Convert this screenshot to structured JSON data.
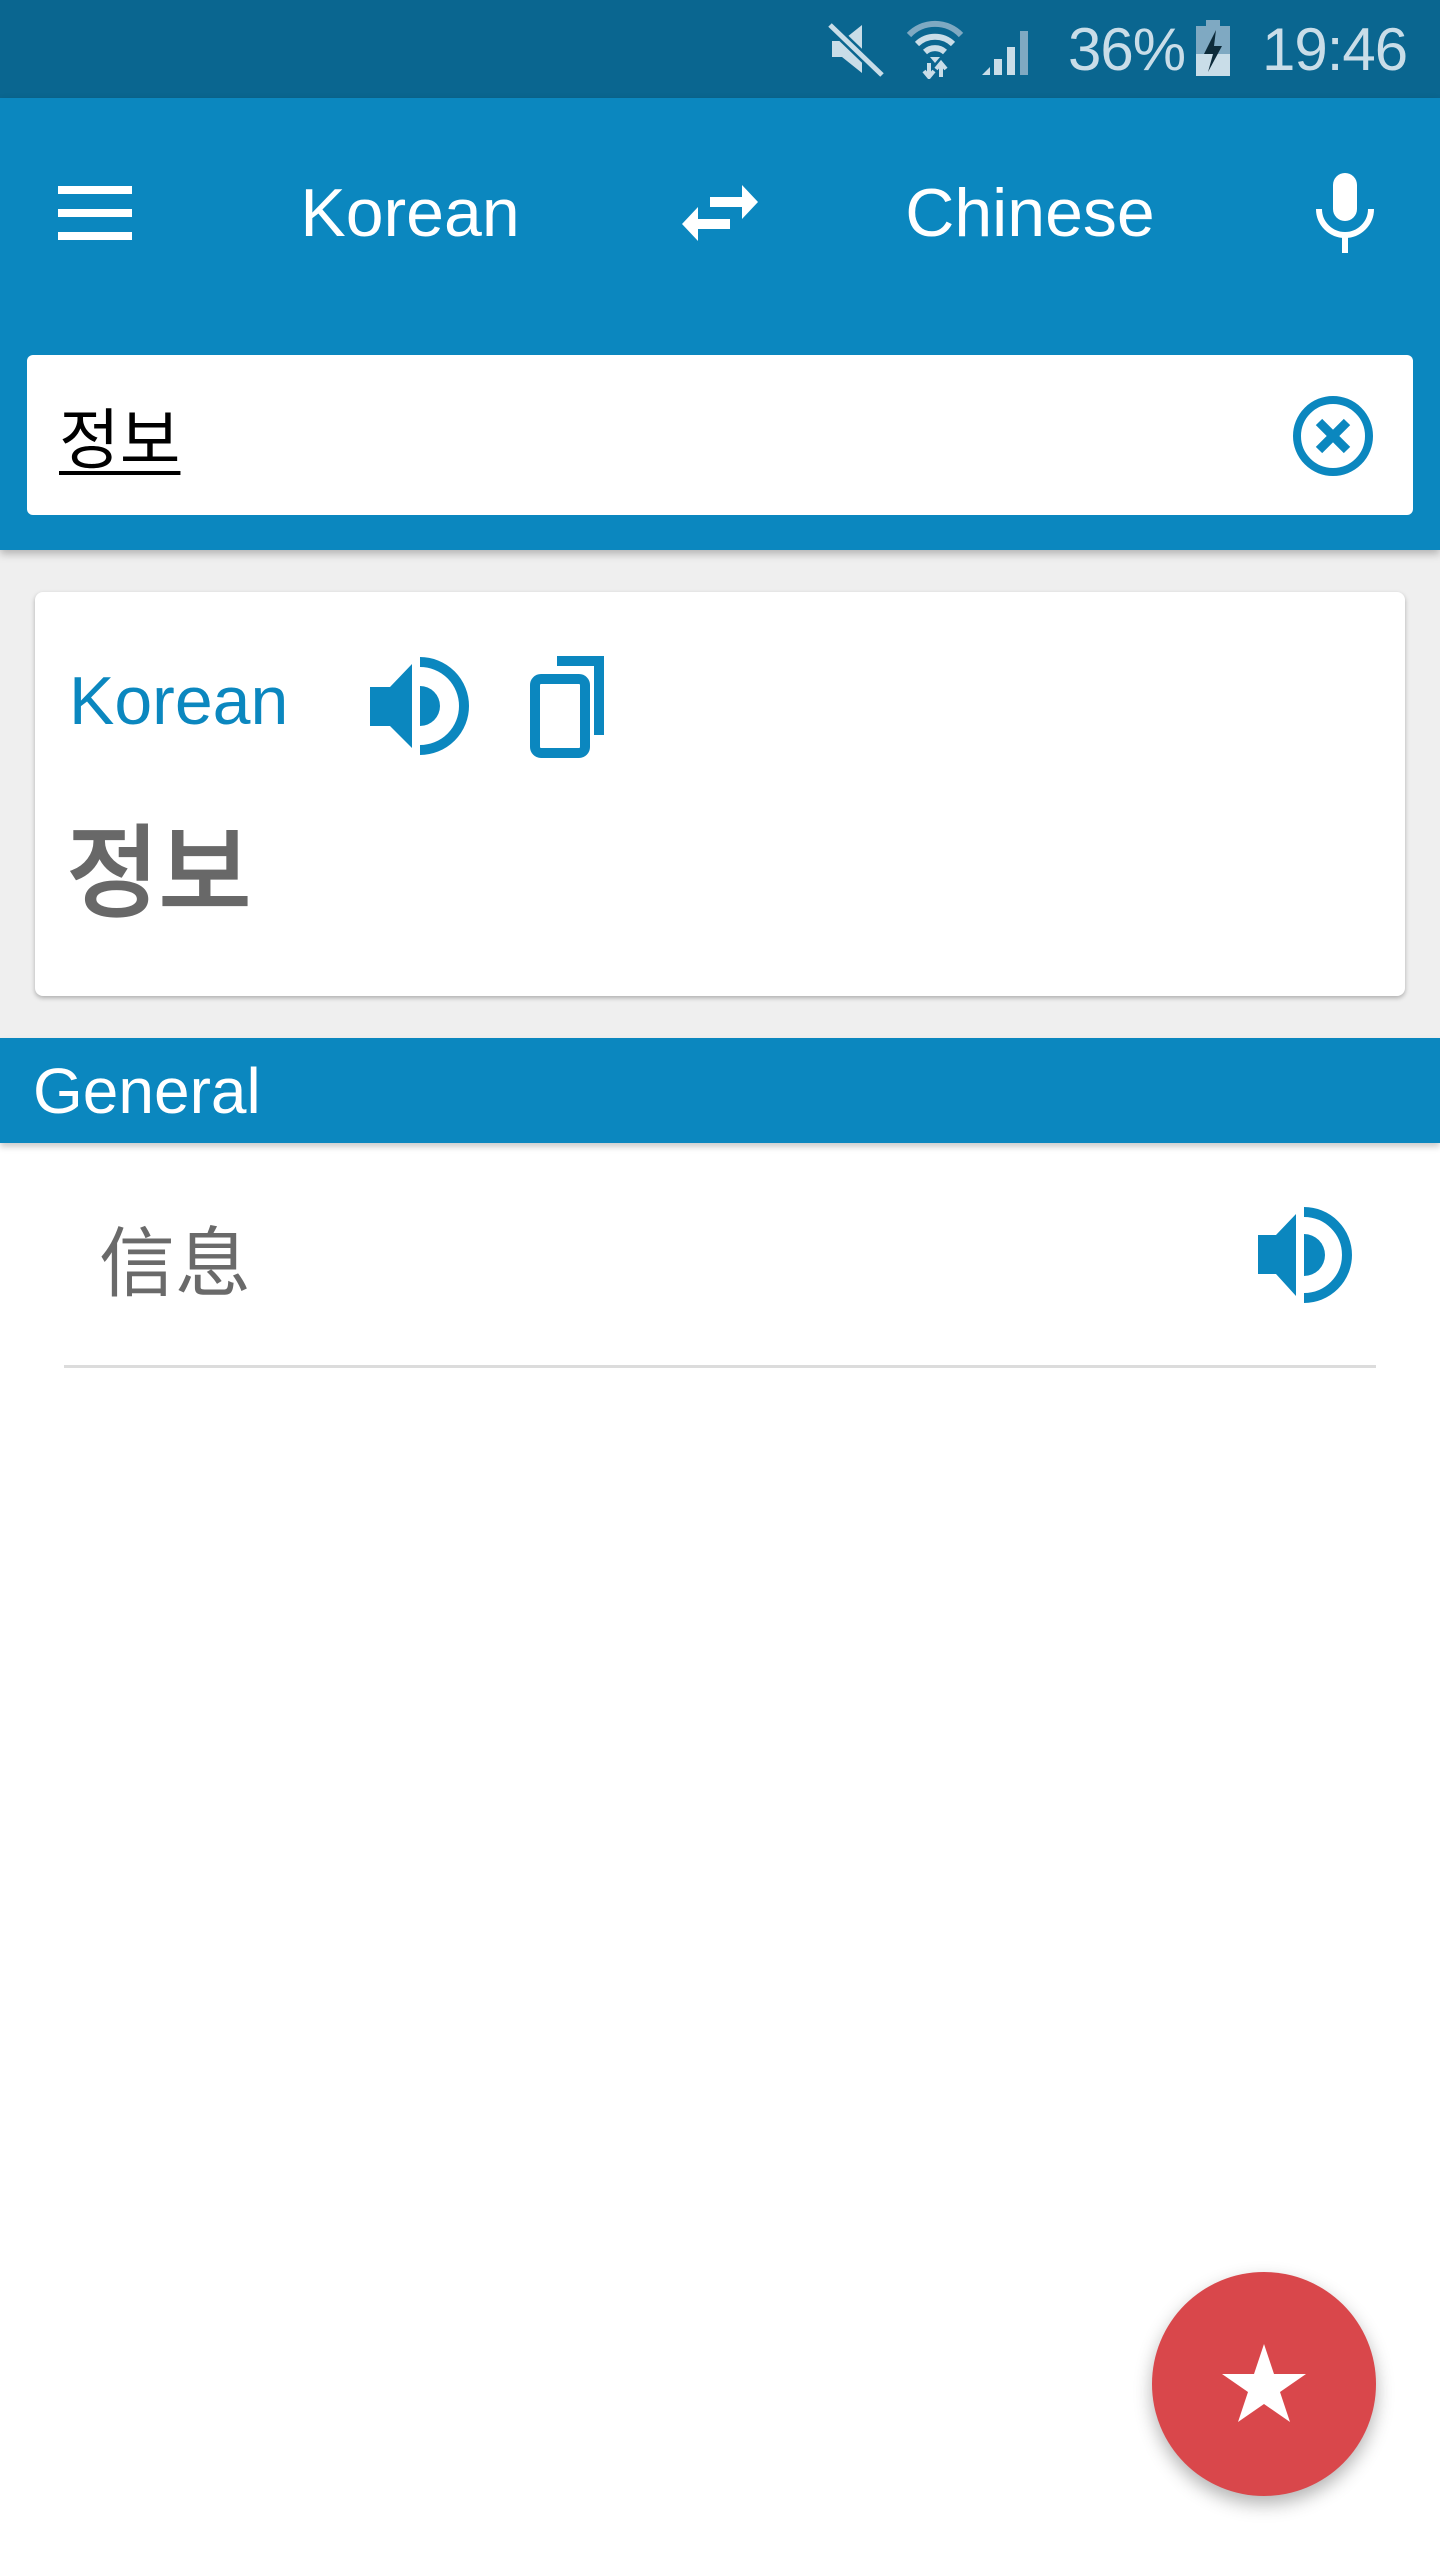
{
  "status_bar": {
    "icons": [
      "mute-icon",
      "wifi-icon",
      "signal-icon",
      "battery-charging-icon"
    ],
    "battery_percent": "36%",
    "time": "19:46"
  },
  "toolbar": {
    "menu_icon": "hamburger-menu-icon",
    "source_language": "Korean",
    "swap_icon": "swap-arrows-icon",
    "target_language": "Chinese",
    "mic_icon": "microphone-icon"
  },
  "search": {
    "value": "정보",
    "placeholder": "",
    "clear_icon": "clear-circle-x-icon"
  },
  "source_card": {
    "language_label": "Korean",
    "speak_icon": "speaker-icon",
    "copy_icon": "copy-icon",
    "word": "정보"
  },
  "results": {
    "section_title": "General",
    "items": [
      {
        "text": "信息",
        "speak_icon": "speaker-icon"
      }
    ]
  },
  "fab": {
    "icon": "star-icon"
  },
  "colors": {
    "status_bar": "#0a6690",
    "primary": "#0b87bf",
    "fab": "#d9474b",
    "background": "#efefef",
    "word_text": "#686868"
  }
}
